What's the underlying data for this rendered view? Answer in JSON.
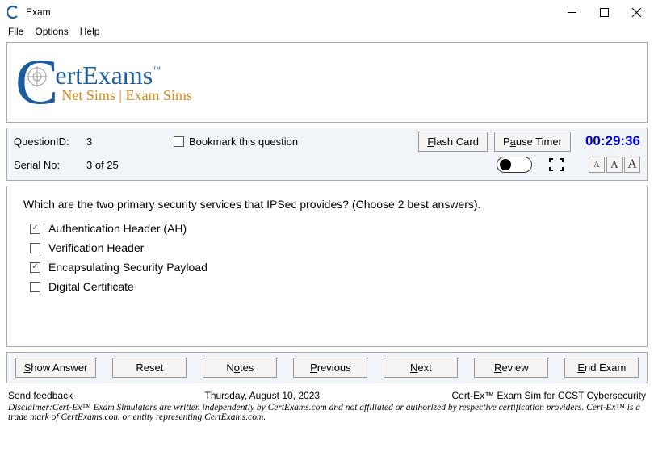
{
  "window": {
    "title": "Exam"
  },
  "menu": {
    "file": "File",
    "options": "Options",
    "help": "Help"
  },
  "logo": {
    "main1": "ert",
    "main2": "Exams",
    "sub": "Net Sims | Exam Sims"
  },
  "info": {
    "qid_label": "QuestionID:",
    "qid_value": "3",
    "serial_label": "Serial No:",
    "serial_value": "3 of 25",
    "bookmark_label": "Bookmark this question",
    "flash_btn": "Flash Card",
    "pause_btn": "Pause Timer",
    "timer": "00:29:36",
    "font_a": "A"
  },
  "question": {
    "text": "Which are the two primary security services that IPSec provides? (Choose 2 best answers).",
    "options": [
      {
        "text": "Authentication Header (AH)",
        "checked": true
      },
      {
        "text": "Verification Header",
        "checked": false
      },
      {
        "text": "Encapsulating Security Payload",
        "checked": true
      },
      {
        "text": "Digital Certificate",
        "checked": false
      }
    ]
  },
  "buttons": {
    "show_answer": "Show Answer",
    "reset": "Reset",
    "notes": "Notes",
    "previous": "Previous",
    "next": "Next",
    "review": "Review",
    "end_exam": "End Exam"
  },
  "footer": {
    "feedback": "Send feedback",
    "date": "Thursday, August 10, 2023",
    "product": "Cert-Ex™ Exam Sim for CCST Cybersecurity",
    "disclaimer": "Disclaimer:Cert-Ex™ Exam Simulators are written independently by CertExams.com and not affiliated or authorized by respective certification providers. Cert-Ex™ is a trade mark of CertExams.com or entity representing CertExams.com."
  }
}
